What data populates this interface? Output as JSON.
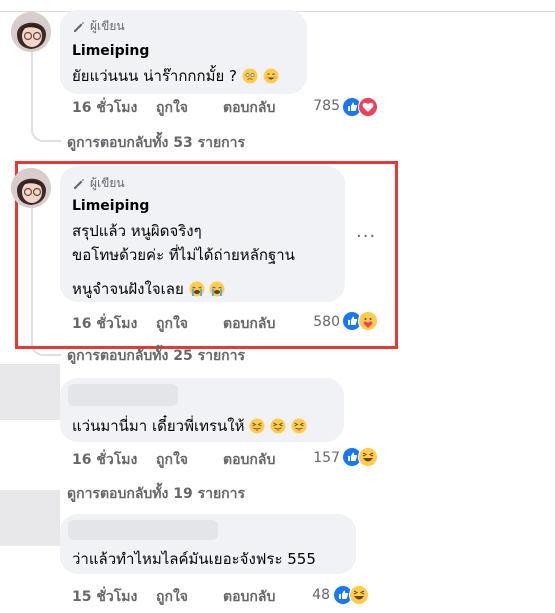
{
  "comments": [
    {
      "badge": "ผู้เขียน",
      "author": "Limeiping",
      "lines": [
        "ยัยแว่นนน น่าร๊ากกกมั้ย ?"
      ],
      "time": "16 ชั่วโมง",
      "like": "ถูกใจ",
      "reply": "ตอบกลับ",
      "reaction_count": "785",
      "reactions": [
        "like-icon",
        "love-icon"
      ],
      "view_replies": "ดูการตอบกลับทั้ง 53 รายการ"
    },
    {
      "badge": "ผู้เขียน",
      "author": "Limeiping",
      "lines": [
        "สรุปแล้ว หนูผิดจริงๆ",
        "ขอโทษด้วยค่ะ ที่ไม่ได้ถ่ายหลักฐาน",
        "หนูจำจนฝังใจเลย"
      ],
      "time": "16 ชั่วโมง",
      "like": "ถูกใจ",
      "reply": "ตอบกลับ",
      "reaction_count": "580",
      "reactions": [
        "like-icon",
        "care-icon"
      ],
      "view_replies": "ดูการตอบกลับทั้ง 25 รายการ",
      "more": "···"
    },
    {
      "lines": [
        "แว่นมานี่มา เดี๋ยวพี่เทรนให้"
      ],
      "time": "16 ชั่วโมง",
      "like": "ถูกใจ",
      "reply": "ตอบกลับ",
      "reaction_count": "157",
      "reactions": [
        "like-icon",
        "haha-icon"
      ],
      "view_replies": "ดูการตอบกลับทั้ง 19 รายการ"
    },
    {
      "lines": [
        "ว่าแล้วทำไหมไลค์มันเยอะจังฟระ 555"
      ],
      "time": "15 ชั่วโมง",
      "like": "ถูกใจ",
      "reply": "ตอบกลับ",
      "reaction_count": "48",
      "reactions": [
        "like-icon",
        "haha-icon"
      ]
    }
  ],
  "colors": {
    "like_blue": "#1877f2",
    "love_red": "#f33e58",
    "highlight_red": "#e43a36",
    "bubble_bg": "#f0f2f5",
    "meta_gray": "#65676b"
  }
}
